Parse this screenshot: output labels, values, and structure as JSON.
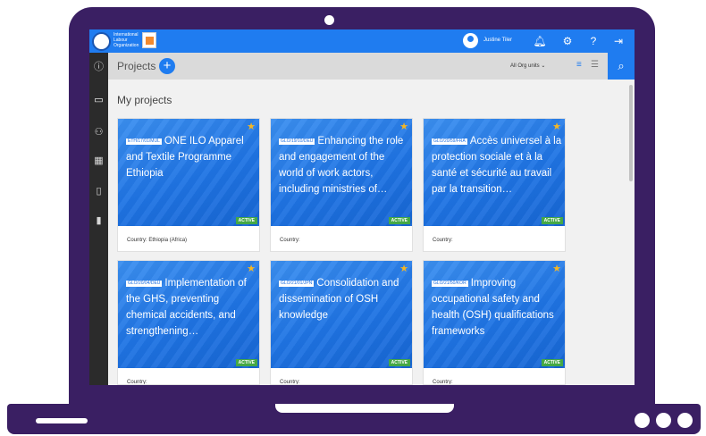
{
  "topbar": {
    "logo_text": "International Labour Organization",
    "user_name": "Justine Tiler"
  },
  "subbar": {
    "title": "Projects",
    "add_symbol": "+",
    "org_filter": "All Org units",
    "org_chevron": "⌄"
  },
  "section_title": "My projects",
  "icons": {
    "topbar": [
      "user-icon",
      "bell-icon",
      "gear-icon",
      "help-icon",
      "logout-icon"
    ],
    "sidebar": [
      "info-icon",
      "folder-icon",
      "people-icon",
      "grid-icon",
      "document-icon",
      "bar-chart-icon"
    ],
    "view": [
      "list-view-icon",
      "compact-list-icon"
    ]
  },
  "projects": [
    {
      "code": "ETH/17/01/MUL",
      "title": "ONE ILO Apparel and Textile Programme Ethiopia",
      "status": "ACTIVE",
      "country": "Country: Ethiopia (Africa)"
    },
    {
      "code": "GLO/19/10/DEU",
      "title": "Enhancing the role and engagement of the world of work actors, including ministries of…",
      "status": "ACTIVE",
      "country": "Country:"
    },
    {
      "code": "GLO/20/59/FRA",
      "title": "Accès universel à la protection sociale et à la santé et sécurité au travail par la transition…",
      "status": "ACTIVE",
      "country": "Country:"
    },
    {
      "code": "GLO/20/04/DEU",
      "title": "Implementation of the GHS, preventing chemical accidents, and strengthening…",
      "status": "ACTIVE",
      "country": "Country:"
    },
    {
      "code": "GLO/21/01/JPN",
      "title": "Consolidation and dissemination of OSH knowledge",
      "status": "ACTIVE",
      "country": "Country:"
    },
    {
      "code": "GLO/21/50/KOR",
      "title": "Improving occupational safety and health (OSH) qualifications frameworks",
      "status": "ACTIVE",
      "country": "Country:"
    }
  ],
  "colors": {
    "frame": "#3a1f63",
    "primary": "#1f7cf0",
    "active_badge": "#45a845",
    "star": "#f5b623"
  }
}
